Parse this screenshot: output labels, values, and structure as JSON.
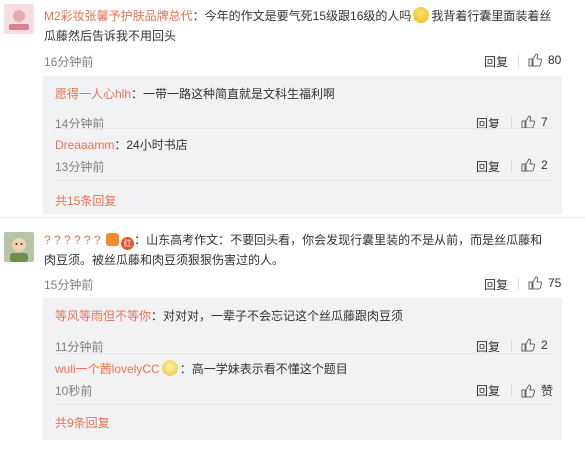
{
  "comments": [
    {
      "user": "M2彩妆张馨予护肤品牌总代",
      "text_a": "：今年的作文是要气死15级跟16级的人吗",
      "text_b": "我背着行囊里面装着丝",
      "text_c": "瓜藤然后告诉我不用回头",
      "time": "16分钟前",
      "reply_label": "回复",
      "likes": "80",
      "replies": [
        {
          "user": "愿得一人心hlh",
          "text": "：一带一路这种简直就是文科生福利啊",
          "time": "14分钟前",
          "reply_label": "回复",
          "likes": "7"
        },
        {
          "user": "Dreaaamm",
          "text": "：24小时书店",
          "time": "13分钟前",
          "reply_label": "回复",
          "likes": "2"
        }
      ],
      "more": "共15条回复"
    },
    {
      "user": "? ? ? ? ? ?",
      "text_a": "：山东高考作文：不要回头看，你会发现行囊里装的不是从前，而是丝瓜藤和",
      "text_b": "肉豆须。被丝瓜藤和肉豆须狠狠伤害过的人。",
      "time": "15分钟前",
      "reply_label": "回复",
      "likes": "75",
      "badge_label": "红",
      "replies": [
        {
          "user": "等风等雨但不等你",
          "text": "：对对对，一辈子不会忘记这个丝瓜藤跟肉豆须",
          "time": "11分钟前",
          "reply_label": "回复",
          "likes": "2"
        },
        {
          "user": "wuli一个茜lovelyCC",
          "text": "：高一学妹表示看不懂这个题目",
          "time": "10秒前",
          "reply_label": "回复",
          "likes": "赞"
        }
      ],
      "more": "共9条回复"
    }
  ],
  "colors": {
    "username": "#eb7350",
    "meta": "#808080",
    "reply_bg": "#f2f2f5"
  }
}
